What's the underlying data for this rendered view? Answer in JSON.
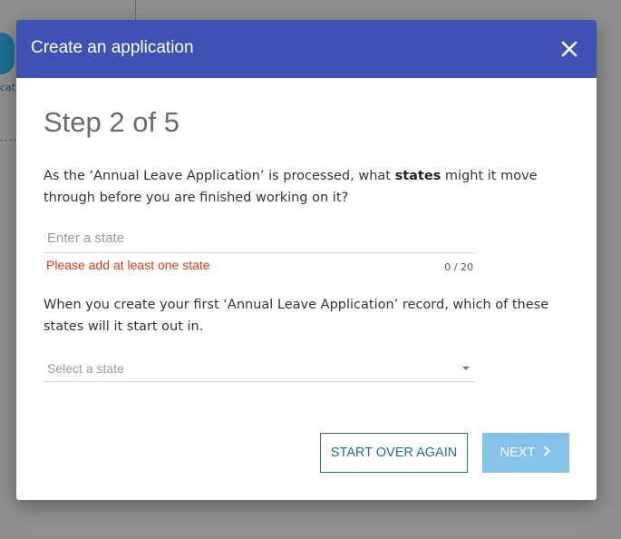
{
  "background": {
    "fragment_label": "cati"
  },
  "dialog": {
    "title": "Create an application",
    "step": "Step 2 of 5",
    "question1": {
      "prefix": "As the ‘Annual Leave Application’ is processed, what ",
      "bold": "states",
      "suffix": " might it move through before you are finished working on it?"
    },
    "state_input": {
      "placeholder": "Enter a state",
      "value": "",
      "error": "Please add at least one state",
      "counter": "0 / 20"
    },
    "question2": "When you create your first ‘Annual Leave Application’ record, which of these states will it start out in.",
    "state_select": {
      "placeholder": "Select a state"
    },
    "buttons": {
      "start_over": "START OVER AGAIN",
      "next": "NEXT"
    }
  },
  "colors": {
    "header": "#3f51b5",
    "error": "#d83a17",
    "outline_button": "#1f6e8f",
    "next_button": "#84c3e7"
  }
}
